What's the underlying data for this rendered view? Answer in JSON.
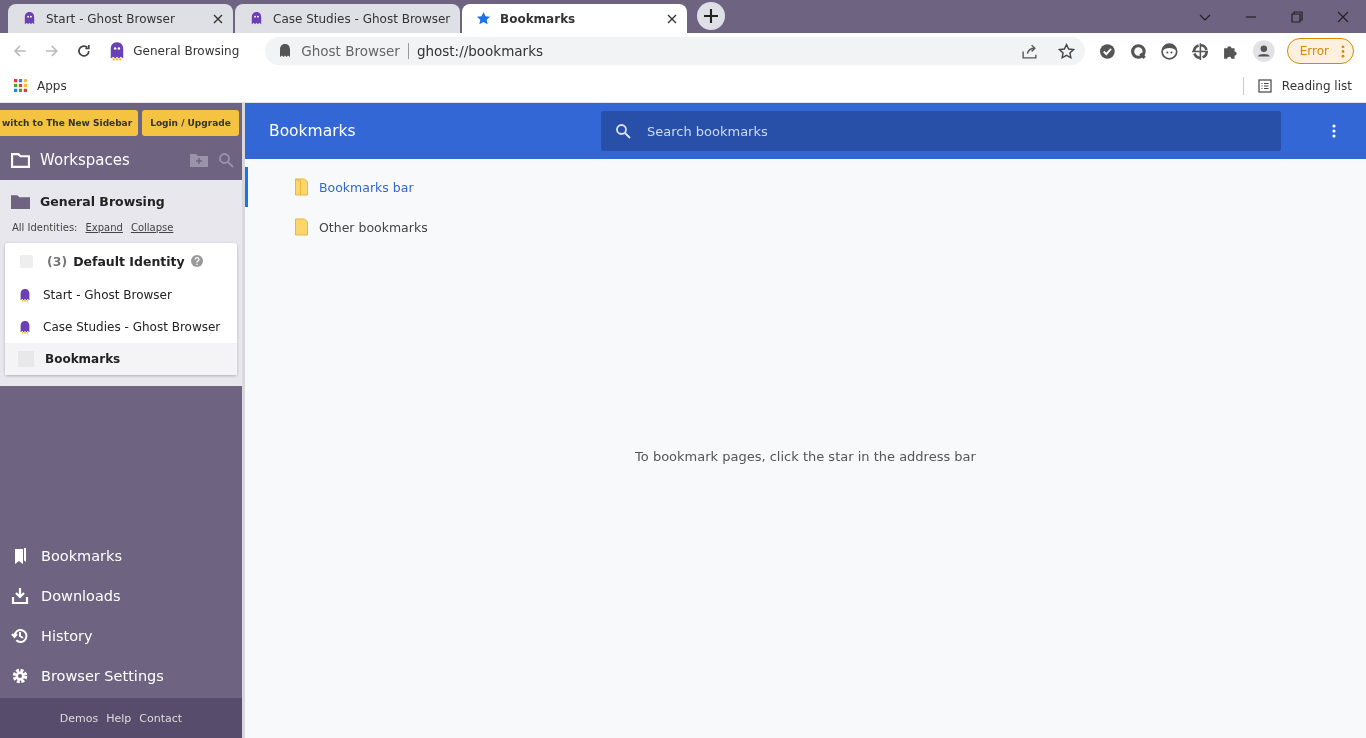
{
  "tabs": [
    {
      "title": "Start - Ghost Browser",
      "kind": "ghost",
      "selected": false
    },
    {
      "title": "Case Studies - Ghost Browser",
      "kind": "ghost",
      "selected": false
    },
    {
      "title": "Bookmarks",
      "kind": "star",
      "selected": true
    }
  ],
  "toolbar": {
    "workspace": "General Browsing",
    "site": "Ghost Browser",
    "url": "ghost://bookmarks",
    "error_button": "Error"
  },
  "bookmarks_bar": {
    "apps": "Apps",
    "reading_list": "Reading list"
  },
  "sidebar": {
    "top_buttons": [
      "witch to The New Sidebar",
      "Login / Upgrade"
    ],
    "workspaces_title": "Workspaces",
    "workspace": {
      "name": "General Browsing",
      "identities_label": "All Identities:",
      "expand": "Expand",
      "collapse": "Collapse"
    },
    "identity": {
      "checked": false,
      "count": "(3)",
      "name": "Default Identity",
      "tabs": [
        {
          "title": "Start - Ghost Browser",
          "kind": "ghost",
          "selected": false
        },
        {
          "title": "Case Studies - Ghost Browser",
          "kind": "ghost",
          "selected": false
        },
        {
          "title": "Bookmarks",
          "kind": "blank",
          "selected": true
        }
      ]
    },
    "nav": [
      {
        "label": "Bookmarks",
        "kind": "bookmark"
      },
      {
        "label": "Downloads",
        "kind": "download"
      },
      {
        "label": "History",
        "kind": "history"
      },
      {
        "label": "Browser Settings",
        "kind": "gear"
      }
    ],
    "footer_links": [
      "Demos",
      "Help",
      "Contact"
    ]
  },
  "main": {
    "title": "Bookmarks",
    "search": {
      "placeholder": "Search bookmarks"
    },
    "folders": [
      {
        "name": "Bookmarks bar",
        "selected": true
      },
      {
        "name": "Other bookmarks",
        "selected": false
      }
    ],
    "empty_message": "To bookmark pages, click the star in the address bar"
  }
}
